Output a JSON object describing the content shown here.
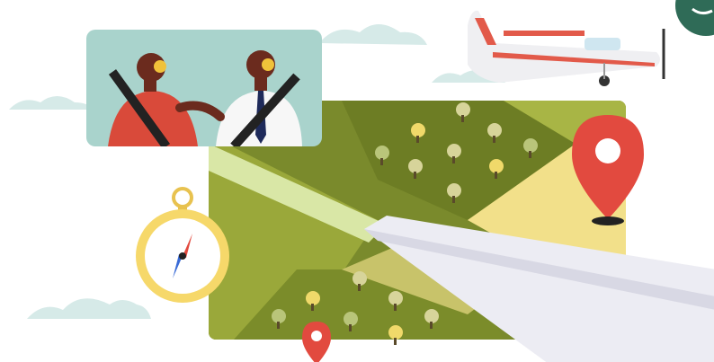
{
  "illustration": {
    "elements": [
      "pilot-cockpit-panel",
      "small-airplane",
      "farmland-map",
      "location-pin-large",
      "location-pin-small",
      "compass",
      "airplane-wing",
      "clouds",
      "corner-badge"
    ]
  },
  "colors": {
    "cockpit_bg": "#a9d3cc",
    "farmland_dark": "#7a8a2c",
    "farmland_mid": "#9aa83a",
    "farmland_light": "#d9e7a6",
    "farmland_yellow": "#f2e08a",
    "pin_red": "#e24a3f",
    "compass_gold": "#e8c24f",
    "airplane_body": "#efeff2",
    "airplane_stripe": "#e25a4a",
    "wing": "#ececf3",
    "cloud": "#d6eae8",
    "badge_green": "#2f6b57"
  }
}
